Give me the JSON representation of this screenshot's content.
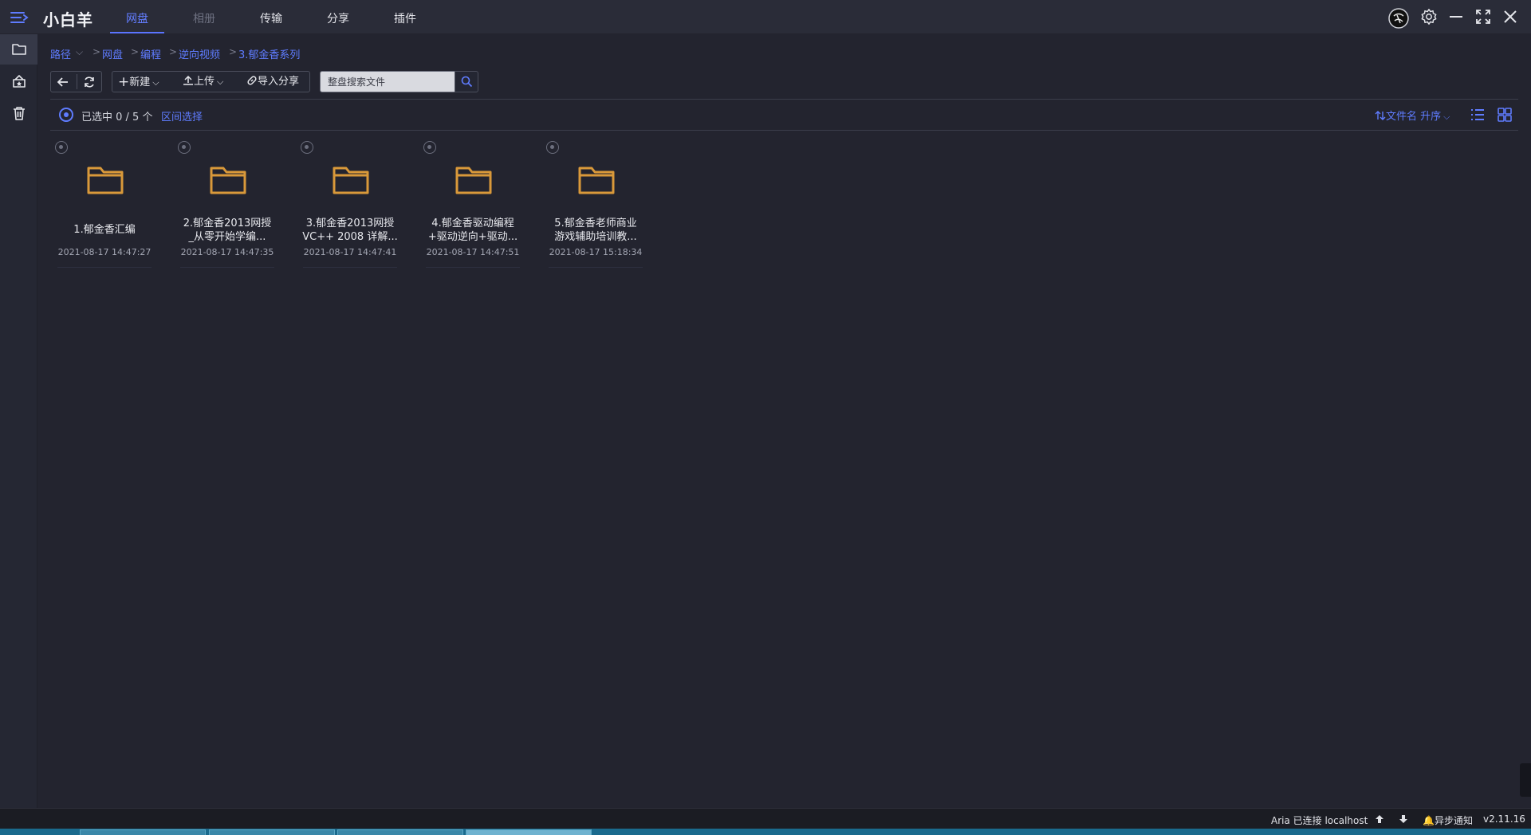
{
  "app": {
    "title": "小白羊"
  },
  "nav": {
    "tabs": [
      {
        "label": "网盘",
        "active": true
      },
      {
        "label": "相册",
        "disabled": true
      },
      {
        "label": "传输"
      },
      {
        "label": "分享"
      },
      {
        "label": "插件"
      }
    ]
  },
  "breadcrumb": {
    "root": "路径",
    "items": [
      "网盘",
      "编程",
      "逆向视频",
      "3.郁金香系列"
    ]
  },
  "toolbar": {
    "new_label": "新建",
    "upload_label": "上传",
    "import_share_label": "导入分享",
    "search_placeholder": "整盘搜索文件"
  },
  "selection": {
    "status": "已选中 0 / 5 个",
    "range_select": "区间选择"
  },
  "sort": {
    "label": "文件名 升序"
  },
  "files": [
    {
      "name_line1": "1.郁金香汇编",
      "name_line2": "",
      "date": "2021-08-17 14:47:27"
    },
    {
      "name_line1": "2.郁金香2013网授",
      "name_line2": "_从零开始学编...",
      "date": "2021-08-17 14:47:35"
    },
    {
      "name_line1": "3.郁金香2013网授",
      "name_line2": "VC++ 2008 详解...",
      "date": "2021-08-17 14:47:41"
    },
    {
      "name_line1": "4.郁金香驱动编程",
      "name_line2": "+驱动逆向+驱动...",
      "date": "2021-08-17 14:47:51"
    },
    {
      "name_line1": "5.郁金香老师商业",
      "name_line2": "游戏辅助培训教...",
      "date": "2021-08-17 15:18:34"
    }
  ],
  "status": {
    "aria": "Aria 已连接 localhost",
    "notify": "异步通知",
    "version": "v2.11.16"
  },
  "colors": {
    "accent": "#5f7cff",
    "folder": "#d9993a",
    "background": "#23242f"
  }
}
